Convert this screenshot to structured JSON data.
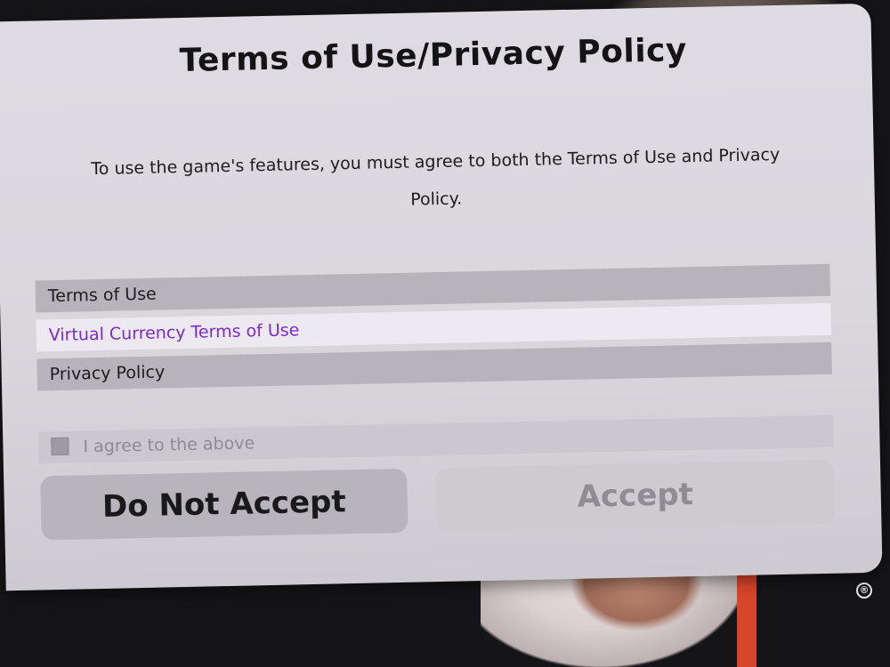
{
  "dialog": {
    "title": "Terms of Use/Privacy Policy",
    "description": "To use the game's features, you must agree to both the Terms of Use and Privacy Policy."
  },
  "links": [
    {
      "label": "Terms of Use",
      "selected": false
    },
    {
      "label": "Virtual Currency Terms of Use",
      "selected": true
    },
    {
      "label": "Privacy Policy",
      "selected": false
    }
  ],
  "agreement": {
    "label": "I agree to the above",
    "checked": false
  },
  "buttons": {
    "decline": "Do Not Accept",
    "accept": "Accept",
    "accept_enabled": false
  },
  "background": {
    "registered_mark": "®"
  },
  "colors": {
    "selected_text": "#7c2cc4",
    "panel": "#dedbe2"
  }
}
